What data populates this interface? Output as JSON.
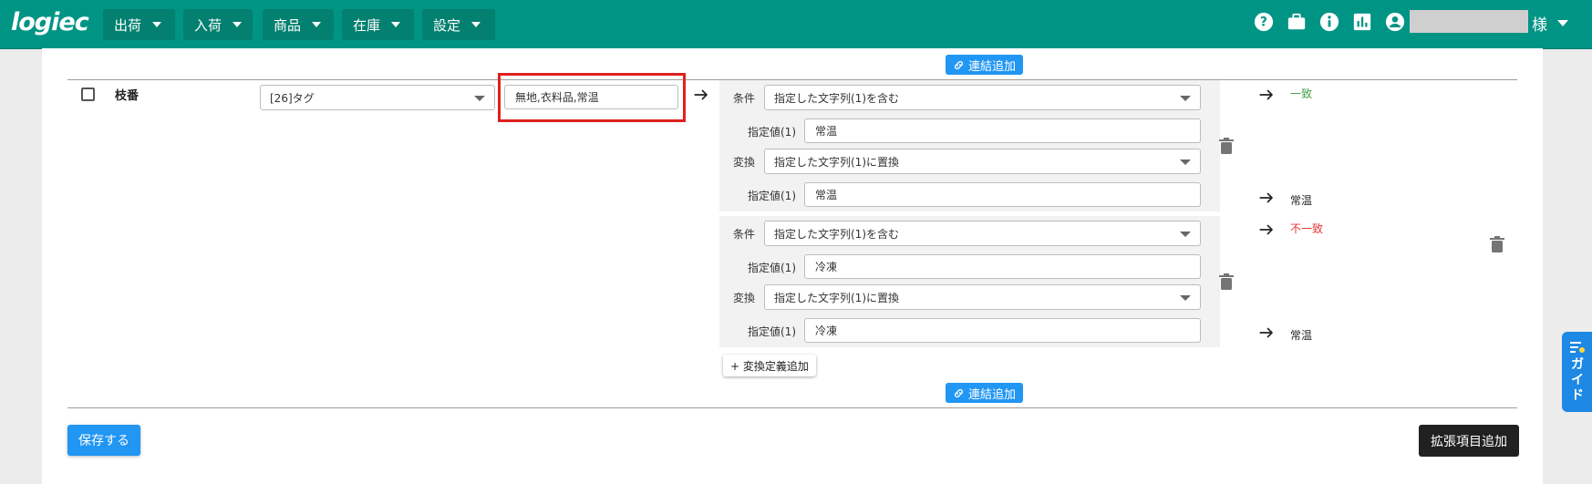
{
  "header": {
    "logo": "logiec",
    "nav": [
      {
        "label": "出荷"
      },
      {
        "label": "入荷"
      },
      {
        "label": "商品"
      },
      {
        "label": "在庫"
      },
      {
        "label": "設定"
      }
    ],
    "icons": [
      "help-icon",
      "briefcase-icon",
      "info-icon",
      "chart-icon",
      "account-icon"
    ],
    "user_suffix": "様"
  },
  "mapping": {
    "link_add_label": "連結追加",
    "row": {
      "field_name": "枝番",
      "source_select": "[26]タグ",
      "source_value": "無地,衣料品,常温"
    },
    "groups": [
      {
        "condition_label": "条件",
        "condition_select": "指定した文字列(1)を含む",
        "condition_value_label": "指定値(1)",
        "condition_value": "常温",
        "convert_label": "変換",
        "convert_select": "指定した文字列(1)に置換",
        "convert_value_label": "指定値(1)",
        "convert_value": "常温",
        "match_result": "一致",
        "output": "常温"
      },
      {
        "condition_label": "条件",
        "condition_select": "指定した文字列(1)を含む",
        "condition_value_label": "指定値(1)",
        "condition_value": "冷凍",
        "convert_label": "変換",
        "convert_select": "指定した文字列(1)に置換",
        "convert_value_label": "指定値(1)",
        "convert_value": "冷凍",
        "match_result": "不一致",
        "output": "常温"
      }
    ],
    "add_definition_label": "+ 変換定義追加"
  },
  "actions": {
    "save_label": "保存する",
    "extend_label": "拡張項目追加"
  },
  "guide_tab": {
    "label": "ガイド"
  },
  "colors": {
    "header": "#009485",
    "nav_button": "#03806f",
    "primary": "#2196f3",
    "match": "#43a047",
    "mismatch": "#e53935",
    "highlight": "#e02020"
  }
}
